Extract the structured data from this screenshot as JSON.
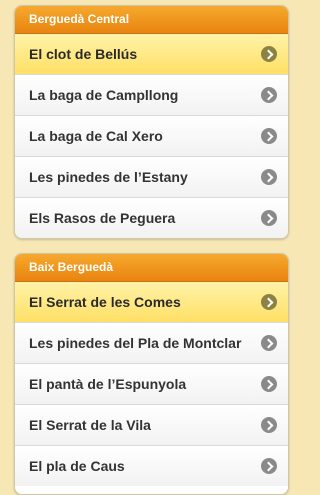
{
  "groups": [
    {
      "title": "Berguedà Central",
      "items": [
        {
          "label": "El clot de Bellús",
          "active": true
        },
        {
          "label": "La baga de Campllong",
          "active": false
        },
        {
          "label": "La baga de Cal Xero",
          "active": false
        },
        {
          "label": "Les pinedes de l’Estany",
          "active": false
        },
        {
          "label": "Els Rasos de Peguera",
          "active": false
        }
      ]
    },
    {
      "title": "Baix Berguedà",
      "items": [
        {
          "label": "El Serrat de les Comes",
          "active": true
        },
        {
          "label": "Les pinedes del Pla de Montclar",
          "active": false
        },
        {
          "label": "El pantà de l’Espunyola",
          "active": false
        },
        {
          "label": "El Serrat de la Vila",
          "active": false
        },
        {
          "label": "El pla de Caus",
          "active": false
        }
      ]
    }
  ],
  "icons": {
    "row_chevron": "chevron-right-icon"
  },
  "colors": {
    "background": "#f6e7b5",
    "header_orange": "#e98410",
    "active_yellow": "#ffe066"
  }
}
